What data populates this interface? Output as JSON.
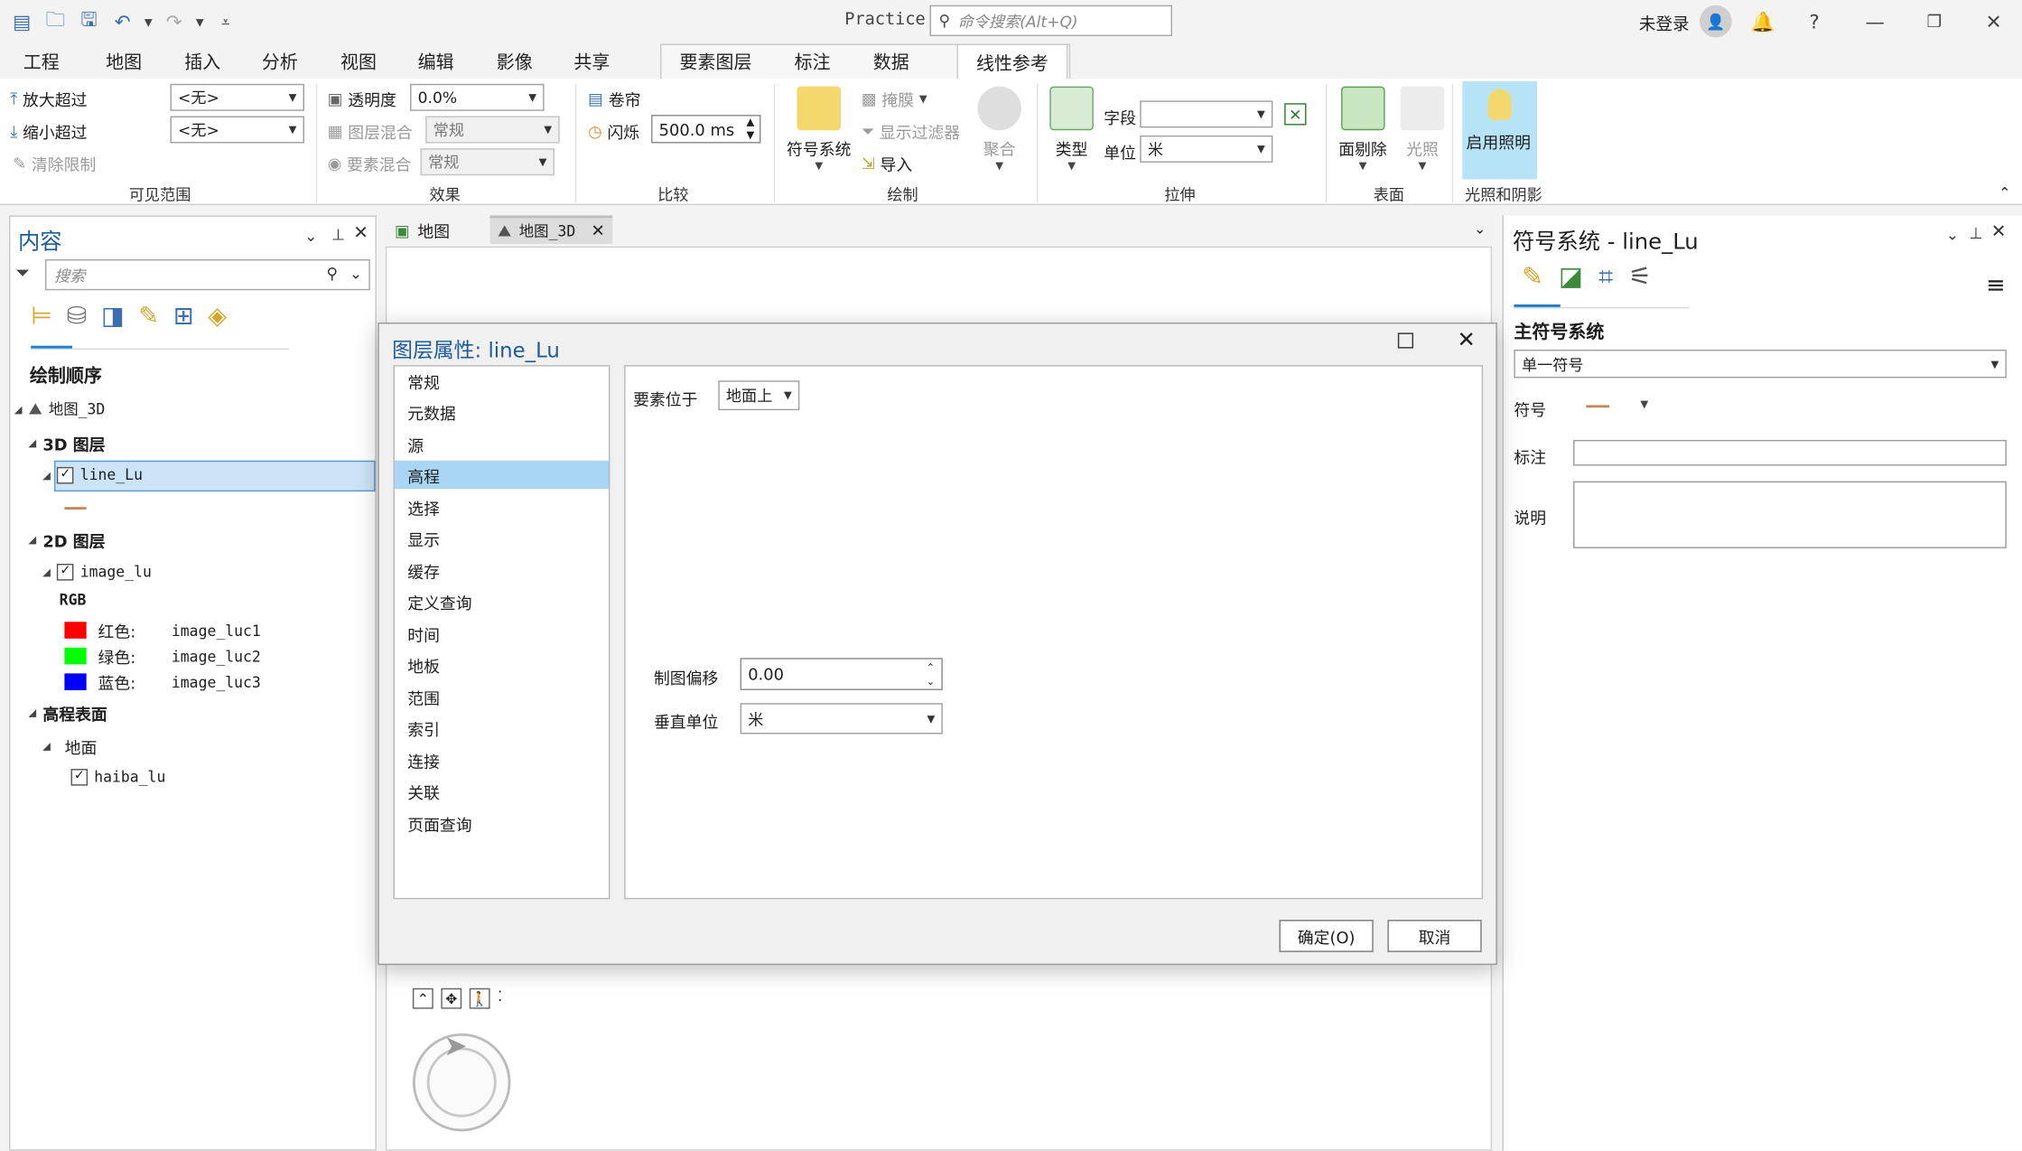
{
  "app": {
    "title": "Practice",
    "command_search_placeholder": "命令搜索(Alt+Q)",
    "login_text": "未登录"
  },
  "ribbon_tabs": [
    "工程",
    "地图",
    "插入",
    "分析",
    "视图",
    "编辑",
    "影像",
    "共享",
    "要素图层",
    "标注",
    "数据",
    "线性参考"
  ],
  "ribbon": {
    "visible_range": {
      "zoom_in_beyond": "放大超过",
      "zoom_out_beyond": "缩小超过",
      "clear_limits": "清除限制",
      "combo1": "<无>",
      "combo2": "<无>",
      "label": "可见范围"
    },
    "effects": {
      "transparency": "透明度",
      "transparency_value": "0.0%",
      "layer_blend": "图层混合",
      "layer_blend_value": "常规",
      "feature_blend": "要素混合",
      "feature_blend_value": "常规",
      "label": "效果"
    },
    "compare": {
      "swipe": "卷帘",
      "flicker": "闪烁",
      "flicker_value": "500.0  ms",
      "label": "比较"
    },
    "drawing": {
      "symbology": "符号系统",
      "mask": "掩膜",
      "display_filter": "显示过滤器",
      "import": "导入",
      "aggregate": "聚合",
      "label": "绘制"
    },
    "extrusion": {
      "type": "类型",
      "field": "字段",
      "unit": "单位",
      "unit_value": "米",
      "label": "拉伸"
    },
    "surface": {
      "face_culling": "面剔除",
      "lighting": "光照",
      "label": "表面"
    },
    "light_shadow": {
      "enable_lighting": "启用照明",
      "label": "光照和阴影"
    }
  },
  "contents": {
    "title": "内容",
    "search_placeholder": "搜索",
    "drawing_order": "绘制顺序",
    "map3d": "地图_3D",
    "layers3d": "3D 图层",
    "line_layer": "line_Lu",
    "layers2d": "2D 图层",
    "image_layer": "image_lu",
    "rgb": "RGB",
    "bands": [
      {
        "label": "红色:",
        "name": "image_luc1",
        "color": "#ff0000"
      },
      {
        "label": "绿色:",
        "name": "image_luc2",
        "color": "#00ff00"
      },
      {
        "label": "蓝色:",
        "name": "image_luc3",
        "color": "#0000ff"
      }
    ],
    "elevation_surfaces": "高程表面",
    "ground": "地面",
    "elevation_layer": "haiba_lu"
  },
  "map_tabs": [
    "地图",
    "地图_3D"
  ],
  "dialog": {
    "title": "图层属性: line_Lu",
    "nav": [
      "常规",
      "元数据",
      "源",
      "高程",
      "选择",
      "显示",
      "缓存",
      "定义查询",
      "时间",
      "地板",
      "范围",
      "索引",
      "连接",
      "关联",
      "页面查询"
    ],
    "selected_nav": "高程",
    "features_on_label": "要素位于",
    "features_on_value": "地面上",
    "carto_offset_label": "制图偏移",
    "carto_offset_value": "0.00",
    "vertical_unit_label": "垂直单位",
    "vertical_unit_value": "米",
    "ok": "确定(O)",
    "cancel": "取消"
  },
  "symbology_pane": {
    "title": "符号系统 - line_Lu",
    "primary_label": "主符号系统",
    "primary_value": "单一符号",
    "symbol_label": "符号",
    "label_label": "标注",
    "description_label": "说明",
    "symbol_color": "#c8875a"
  },
  "colors": {
    "accent": "#1b5b9a",
    "selected": "#a9d6f5",
    "light_button": "#b7e3f7"
  }
}
